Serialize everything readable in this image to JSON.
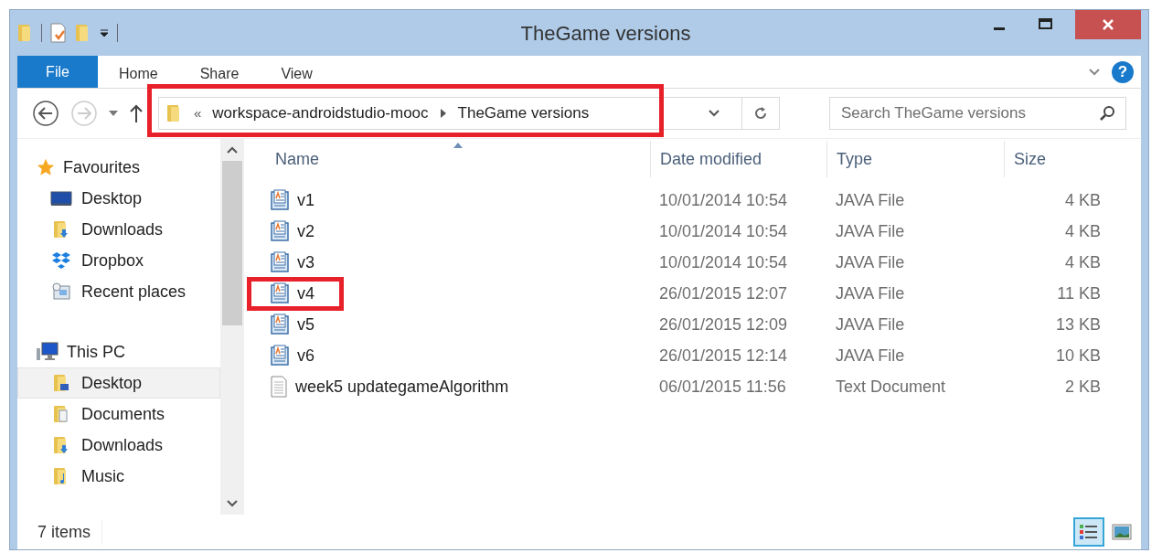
{
  "window": {
    "title": "TheGame versions"
  },
  "ribbon_tabs": [
    {
      "label": "File",
      "kind": "file"
    },
    {
      "label": "Home",
      "kind": "tab"
    },
    {
      "label": "Share",
      "kind": "tab"
    },
    {
      "label": "View",
      "kind": "tab"
    }
  ],
  "help": {
    "label": "?"
  },
  "address_bar": {
    "overflow": "«",
    "segments": [
      "workspace-androidstudio-mooc",
      "TheGame versions"
    ],
    "highlighted": true
  },
  "search": {
    "placeholder": "Search TheGame versions"
  },
  "sidebar": {
    "groups": [
      {
        "label": "Favourites",
        "kind": "favourites",
        "children": [
          {
            "label": "Desktop",
            "kind": "desktop",
            "selected": false
          },
          {
            "label": "Downloads",
            "kind": "downloads",
            "selected": false
          },
          {
            "label": "Dropbox",
            "kind": "dropbox",
            "selected": false
          },
          {
            "label": "Recent places",
            "kind": "recent",
            "selected": false
          }
        ]
      },
      {
        "label": "This PC",
        "kind": "pc",
        "children": [
          {
            "label": "Desktop",
            "kind": "desktop-folder",
            "selected": true
          },
          {
            "label": "Documents",
            "kind": "documents",
            "selected": false
          },
          {
            "label": "Downloads",
            "kind": "downloads",
            "selected": false
          },
          {
            "label": "Music",
            "kind": "music",
            "selected": false
          }
        ]
      }
    ]
  },
  "table": {
    "columns": [
      {
        "label": "Name",
        "sorted": true
      },
      {
        "label": "Date modified",
        "sorted": false
      },
      {
        "label": "Type",
        "sorted": false
      },
      {
        "label": "Size",
        "sorted": false
      }
    ],
    "rows": [
      {
        "kind": "java",
        "name": "v1",
        "date": "10/01/2014 10:54",
        "type": "JAVA File",
        "size": "4 KB",
        "highlighted": false
      },
      {
        "kind": "java",
        "name": "v2",
        "date": "10/01/2014 10:54",
        "type": "JAVA File",
        "size": "4 KB",
        "highlighted": false
      },
      {
        "kind": "java",
        "name": "v3",
        "date": "10/01/2014 10:54",
        "type": "JAVA File",
        "size": "4 KB",
        "highlighted": false
      },
      {
        "kind": "java",
        "name": "v4",
        "date": "26/01/2015 12:07",
        "type": "JAVA File",
        "size": "11 KB",
        "highlighted": true
      },
      {
        "kind": "java",
        "name": "v5",
        "date": "26/01/2015 12:09",
        "type": "JAVA File",
        "size": "13 KB",
        "highlighted": false
      },
      {
        "kind": "java",
        "name": "v6",
        "date": "26/01/2015 12:14",
        "type": "JAVA File",
        "size": "10 KB",
        "highlighted": false
      },
      {
        "kind": "text",
        "name": "week5 updategameAlgorithm",
        "date": "06/01/2015 11:56",
        "type": "Text Document",
        "size": "2 KB",
        "highlighted": false
      }
    ]
  },
  "status_bar": {
    "count": "7 items",
    "views": [
      {
        "kind": "details",
        "selected": true
      },
      {
        "kind": "large-icons",
        "selected": false
      }
    ]
  }
}
